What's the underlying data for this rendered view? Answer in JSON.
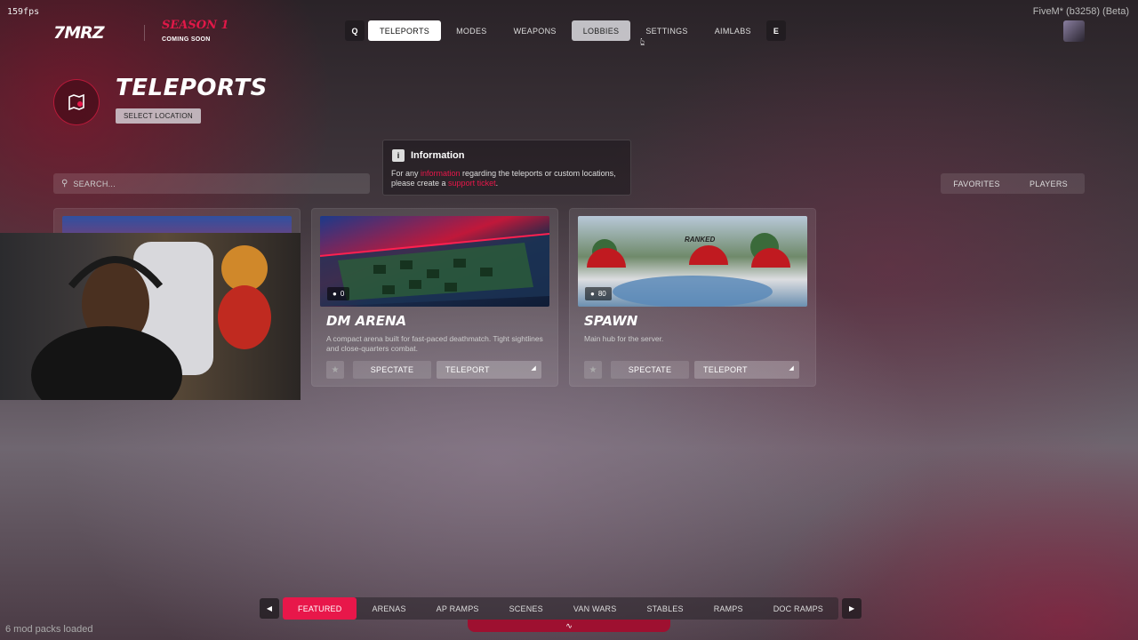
{
  "overlay": {
    "fps": "159fps",
    "fivem": "FiveM* (b3258) (Beta)",
    "mods": "6 mod packs loaded"
  },
  "brand": {
    "logo": "7MRZ",
    "season": "SEASON 1",
    "coming_soon": "COMING SOON"
  },
  "nav": {
    "left_key": "Q",
    "right_key": "E",
    "items": [
      {
        "label": "TELEPORTS",
        "state": "active"
      },
      {
        "label": "MODES",
        "state": ""
      },
      {
        "label": "WEAPONS",
        "state": ""
      },
      {
        "label": "LOBBIES",
        "state": "hover"
      },
      {
        "label": "SETTINGS",
        "state": ""
      },
      {
        "label": "AIMLABS",
        "state": ""
      }
    ]
  },
  "header": {
    "title": "TELEPORTS",
    "subtitle": "SELECT LOCATION"
  },
  "info": {
    "title": "Information",
    "text_1": "For any ",
    "link_1": "information",
    "text_2": " regarding the teleports or custom locations, please create a ",
    "link_2": "support ticket",
    "text_3": "."
  },
  "search": {
    "placeholder": "SEARCH..."
  },
  "filter_tabs": [
    "FAVORITES",
    "PLAYERS"
  ],
  "cards": [
    {
      "title": "DM ARENA",
      "players": "0",
      "description": "A compact arena built for fast-paced deathmatch. Tight sightlines and close-quarters combat.",
      "spectate": "SPECTATE",
      "teleport": "TELEPORT"
    },
    {
      "title": "SPAWN",
      "players": "80",
      "description": "Main hub for the server.",
      "spectate": "SPECTATE",
      "teleport": "TELEPORT",
      "image_text": "RANKED"
    }
  ],
  "categories": [
    {
      "label": "FEATURED",
      "active": true
    },
    {
      "label": "ARENAS",
      "active": false
    },
    {
      "label": "AP RAMPS",
      "active": false
    },
    {
      "label": "SCENES",
      "active": false
    },
    {
      "label": "VAN WARS",
      "active": false
    },
    {
      "label": "STABLES",
      "active": false
    },
    {
      "label": "RAMPS",
      "active": false
    },
    {
      "label": "DOC RAMPS",
      "active": false
    }
  ],
  "colors": {
    "accent": "#e8174a",
    "active_tab": "#ffffff"
  },
  "icons": {
    "teleports_header": "map-pin-icon",
    "info": "info-icon",
    "search": "search-icon",
    "star": "star-icon",
    "player": "user-icon"
  }
}
